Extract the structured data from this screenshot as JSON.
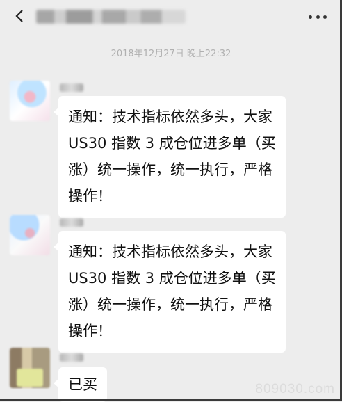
{
  "header": {
    "back_icon": "chevron-left-icon",
    "more_icon": "more-dots-icon"
  },
  "timestamp": "2018年12月27日 晚上22:32",
  "messages": [
    {
      "lines": [
        "通知：技术指标依然多头，大家",
        "US30 指数 3 成仓位进多单（买",
        "涨）统一操作，统一执行，严格",
        "操作！"
      ]
    },
    {
      "lines": [
        "通知：技术指标依然多头，大家",
        "US30 指数 3 成仓位进多单（买",
        "涨）统一操作，统一执行，严格",
        "操作！"
      ]
    },
    {
      "lines": [
        "已买"
      ]
    }
  ],
  "watermark": "809030.com"
}
